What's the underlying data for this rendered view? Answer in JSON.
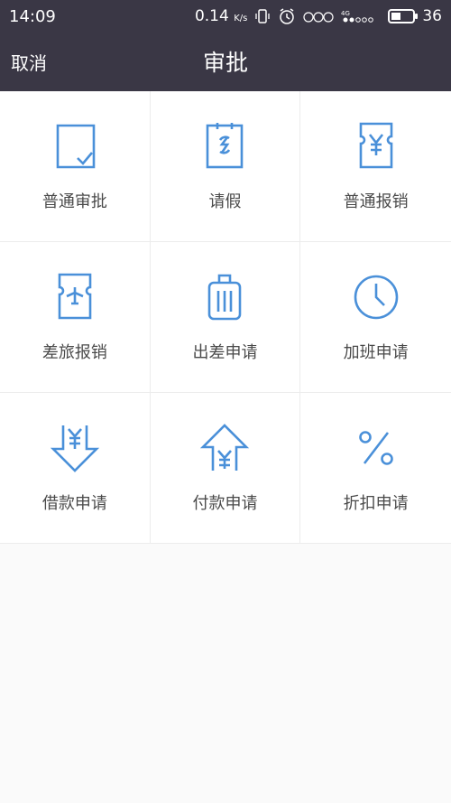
{
  "status": {
    "time": "14:09",
    "speed": "0.14",
    "speed_unit": "K/s",
    "network": "4G",
    "battery": "36"
  },
  "header": {
    "cancel_label": "取消",
    "title": "审批"
  },
  "accent_color": "#4a90d9",
  "items": [
    {
      "label": "普通审批",
      "icon": "document-check-icon"
    },
    {
      "label": "请假",
      "icon": "calendar-leave-icon"
    },
    {
      "label": "普通报销",
      "icon": "receipt-yen-icon"
    },
    {
      "label": "差旅报销",
      "icon": "ticket-plane-icon"
    },
    {
      "label": "出差申请",
      "icon": "luggage-icon"
    },
    {
      "label": "加班申请",
      "icon": "clock-icon"
    },
    {
      "label": "借款申请",
      "icon": "yen-arrow-down-icon"
    },
    {
      "label": "付款申请",
      "icon": "yen-arrow-up-icon"
    },
    {
      "label": "折扣申请",
      "icon": "percent-icon"
    }
  ]
}
